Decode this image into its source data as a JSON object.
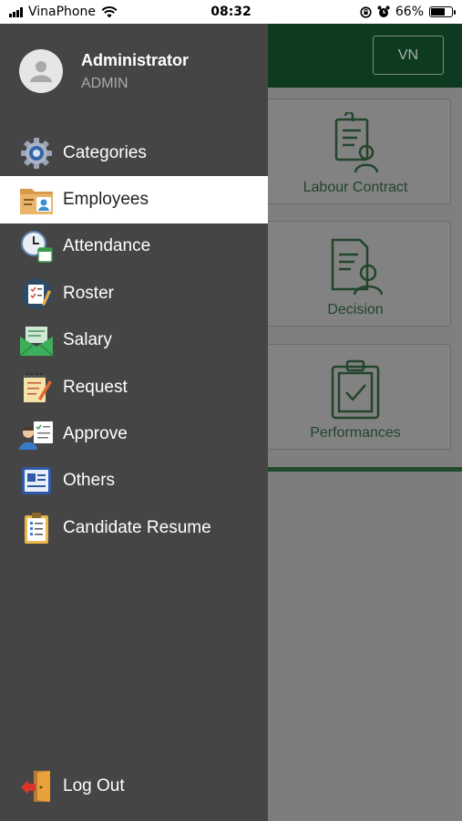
{
  "status_bar": {
    "carrier": "VinaPhone",
    "time": "08:32",
    "battery_percent": "66%",
    "battery_level": 0.66,
    "icons": [
      "signal-icon",
      "wifi-icon",
      "orientation-lock-icon",
      "alarm-icon",
      "battery-icon"
    ]
  },
  "app": {
    "language_button": "VN",
    "cards": [
      {
        "label": "Labour Contract",
        "icon": "contract-icon"
      },
      {
        "label": "Decision",
        "icon": "decision-icon"
      },
      {
        "label": "Performances",
        "icon": "clipboard-check-icon"
      }
    ],
    "colors": {
      "header": "#0e3a1f",
      "accent_green": "#1f4b2a"
    }
  },
  "drawer": {
    "user": {
      "name": "Administrator",
      "role": "ADMIN"
    },
    "items": [
      {
        "label": "Categories",
        "icon": "gear-icon"
      },
      {
        "label": "Employees",
        "icon": "employee-folder-icon",
        "active": true
      },
      {
        "label": "Attendance",
        "icon": "clock-calendar-icon"
      },
      {
        "label": "Roster",
        "icon": "checklist-pencil-icon"
      },
      {
        "label": "Salary",
        "icon": "envelope-money-icon"
      },
      {
        "label": "Request",
        "icon": "notepad-pencil-icon"
      },
      {
        "label": "Approve",
        "icon": "approve-person-icon"
      },
      {
        "label": "Others",
        "icon": "id-card-icon"
      },
      {
        "label": "Candidate Resume",
        "icon": "resume-clipboard-icon"
      }
    ],
    "logout": {
      "label": "Log Out",
      "icon": "logout-door-icon"
    },
    "colors": {
      "background": "#454545",
      "active": "#ffffff"
    }
  }
}
